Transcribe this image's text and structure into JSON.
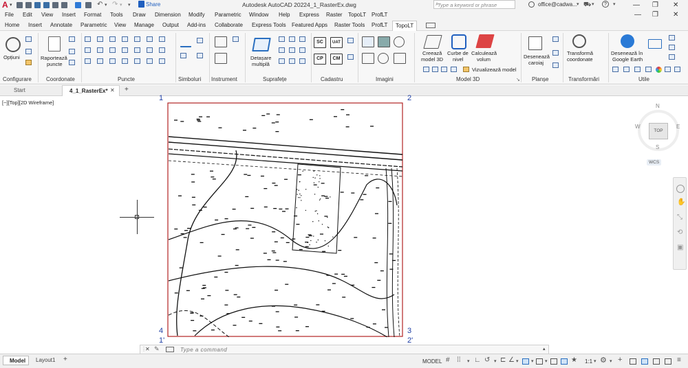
{
  "app": {
    "title": "Autodesk AutoCAD 2022",
    "filename": "4_1_RasterEx.dwg",
    "share_label": "Share",
    "search_placeholder": "Type a keyword or phrase",
    "user": "office@cadwa...",
    "logo": "A"
  },
  "menubar": [
    "File",
    "Edit",
    "View",
    "Insert",
    "Format",
    "Tools",
    "Draw",
    "Dimension",
    "Modify",
    "Parametric",
    "Window",
    "Help",
    "Express",
    "Raster",
    "TopoLT",
    "ProfLT"
  ],
  "ribbon_tabs": [
    "Home",
    "Insert",
    "Annotate",
    "Parametric",
    "View",
    "Manage",
    "Output",
    "Add-ins",
    "Collaborate",
    "Express Tools",
    "Featured Apps",
    "Raster Tools",
    "ProfLT",
    "TopoLT"
  ],
  "active_tab": "TopoLT",
  "ribbon": {
    "optiuni": "Opțiuni",
    "raporteaza_1": "Raportează",
    "raporteaza_2": "puncte",
    "detasare_1": "Detașare",
    "detasare_2": "multiplă",
    "creeaza_1": "Creează",
    "creeaza_2": "model 3D",
    "curbe_1": "Curbe de",
    "curbe_2": "nivel",
    "calculeaza_1": "Calculează",
    "calculeaza_2": "volum",
    "vizualizeaza": "Vizualizează model",
    "deseneaza_carolaj_1": "Desenează",
    "deseneaza_carolaj_2": "caroiaj",
    "transforma_1": "Transformă",
    "transforma_2": "coordonate",
    "google_1": "Desenează în",
    "google_2": "Google Earth",
    "cadastru_sc": "SC",
    "cadastru_uat": "UAT",
    "cadastru_cp": "CP",
    "cadastru_cm": "CM",
    "panels": [
      "Configurare",
      "Coordonate",
      "Puncte",
      "Simboluri",
      "Instrument",
      "Suprafețe",
      "Cadastru",
      "Imagini",
      "Model 3D",
      "Planșe",
      "Transformări",
      "Utile"
    ]
  },
  "doctabs": {
    "start": "Start",
    "active": "4_1_RasterEx*"
  },
  "viewport": {
    "label": "[−][Top][2D Wireframe]",
    "corner_1": "1",
    "corner_2": "2",
    "corner_3": "3",
    "corner_4": "4",
    "corner_1p": "1'",
    "corner_2p": "2'"
  },
  "viewcube": {
    "north": "N",
    "south": "S",
    "east": "E",
    "west": "W",
    "face": "TOP",
    "wcs": "WCS"
  },
  "command": {
    "placeholder": "Type a command"
  },
  "status": {
    "model_tab": "Model",
    "layout_tab": "Layout1",
    "model_label": "MODEL",
    "scale": "1:1"
  },
  "colors": {
    "accent": "#1f5fbf",
    "drawing_border": "#b22222",
    "logo": "#c8102e"
  }
}
